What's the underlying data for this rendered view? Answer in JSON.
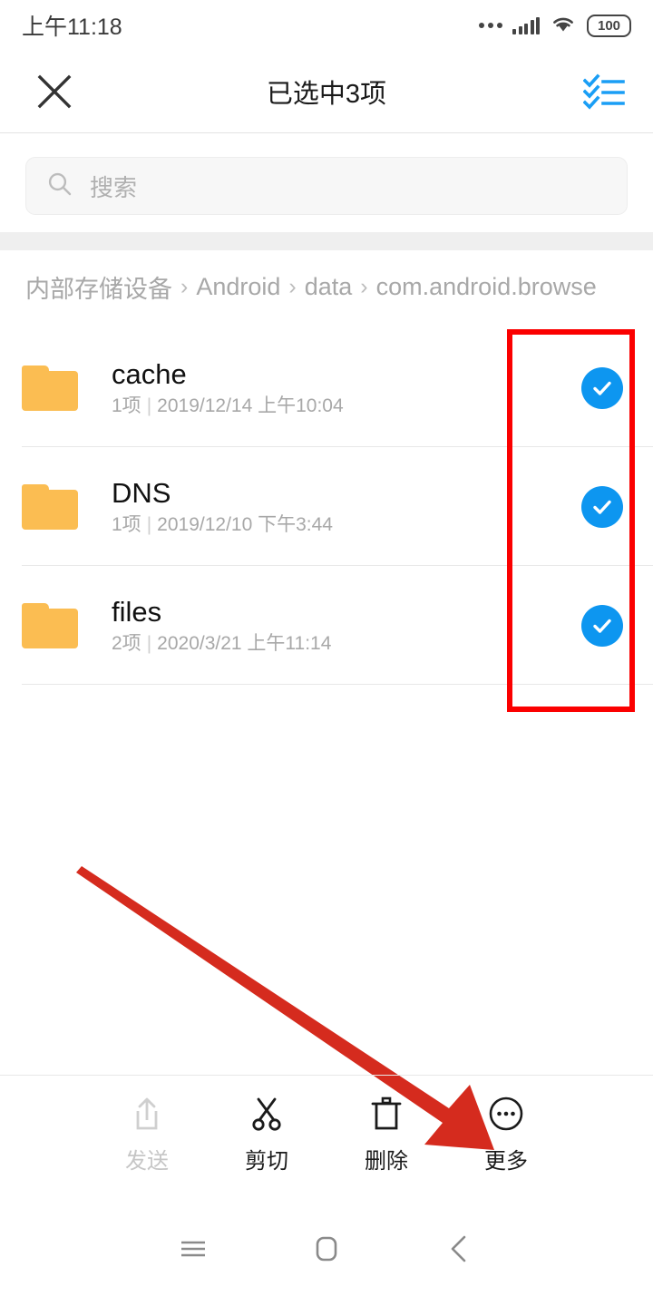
{
  "statusbar": {
    "time": "上午11:18",
    "battery_level": "100",
    "icons": [
      "three-dots-icon",
      "signal-bars-icon",
      "wifi-icon",
      "battery-icon"
    ]
  },
  "appbar": {
    "close_label": "关闭",
    "title": "已选中3项",
    "select_all_label": "全选"
  },
  "search": {
    "placeholder": "搜索",
    "value": ""
  },
  "breadcrumb": {
    "separator": "›",
    "items": [
      {
        "label": "内部存储设备"
      },
      {
        "label": "Android"
      },
      {
        "label": "data"
      },
      {
        "label": "com.android.browse"
      }
    ]
  },
  "file_list": {
    "meta_separator": "|",
    "rows": [
      {
        "name": "cache",
        "count": "1项",
        "modified": "2019/12/14 上午10:04",
        "icon": "folder-icon",
        "selected": true
      },
      {
        "name": "DNS",
        "count": "1项",
        "modified": "2019/12/10 下午3:44",
        "icon": "folder-icon",
        "selected": true
      },
      {
        "name": "files",
        "count": "2项",
        "modified": "2020/3/21 上午11:14",
        "icon": "folder-icon",
        "selected": true
      }
    ]
  },
  "toolbar": {
    "items": [
      {
        "label": "发送",
        "icon": "share-upload-icon",
        "disabled": true
      },
      {
        "label": "剪切",
        "icon": "scissors-icon",
        "disabled": false
      },
      {
        "label": "删除",
        "icon": "trash-icon",
        "disabled": false
      },
      {
        "label": "更多",
        "icon": "more-ellipsis-icon",
        "disabled": false
      }
    ]
  },
  "navbar": {
    "items": [
      {
        "label": "菜单",
        "icon": "menu-hamburger-icon"
      },
      {
        "label": "主页",
        "icon": "home-square-icon"
      },
      {
        "label": "返回",
        "icon": "back-chevron-icon"
      }
    ]
  },
  "annotations": {
    "highlight_box_color": "#fb0000",
    "arrow_color": "#d52b1e",
    "box_target": "checkbox-column",
    "arrow_target": "更多"
  },
  "colors": {
    "accent_blue": "#0d96f0",
    "folder_orange": "#fbbd52",
    "annotation_red": "#fb0000",
    "text_primary": "#111111",
    "text_muted": "#a8a8a8"
  }
}
